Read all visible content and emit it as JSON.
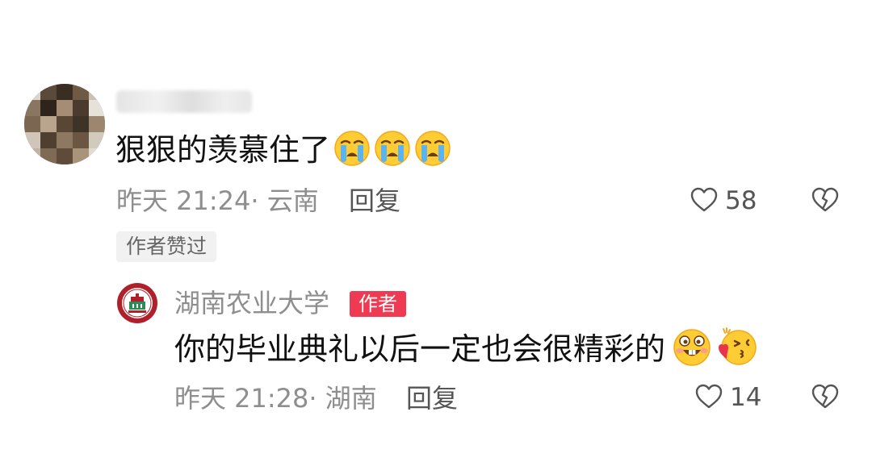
{
  "comment": {
    "text": "狠狠的羡慕住了",
    "emojis": [
      "crying-face",
      "crying-face",
      "crying-face"
    ],
    "time": "昨天 21:24",
    "location": "· 云南",
    "reply_label": "回复",
    "likes": "58",
    "author_liked_badge": "作者赞过"
  },
  "reply": {
    "author_name": "湖南农业大学",
    "author_badge": "作者",
    "text": "你的毕业典礼以后一定也会很精彩的",
    "emojis": [
      "grinning-buck-teeth-face",
      "kissing-heart-face"
    ],
    "time": "昨天 21:28",
    "location": "· 湖南",
    "reply_label": "回复",
    "likes": "14"
  },
  "colors": {
    "author_badge": "#ee3a52",
    "meta_text": "#8e8e8e",
    "emoji_yellow": "#ffcc33"
  }
}
